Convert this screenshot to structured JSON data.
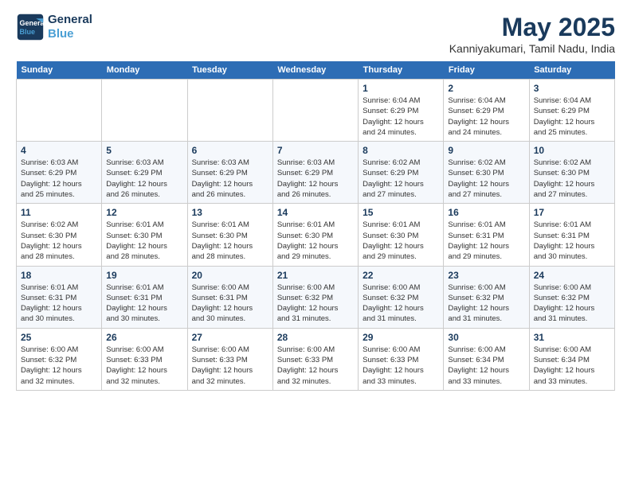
{
  "logo": {
    "line1": "General",
    "line2": "Blue"
  },
  "title": "May 2025",
  "location": "Kanniyakumari, Tamil Nadu, India",
  "days_of_week": [
    "Sunday",
    "Monday",
    "Tuesday",
    "Wednesday",
    "Thursday",
    "Friday",
    "Saturday"
  ],
  "weeks": [
    [
      {
        "day": "",
        "content": ""
      },
      {
        "day": "",
        "content": ""
      },
      {
        "day": "",
        "content": ""
      },
      {
        "day": "",
        "content": ""
      },
      {
        "day": "1",
        "content": "Sunrise: 6:04 AM\nSunset: 6:29 PM\nDaylight: 12 hours\nand 24 minutes."
      },
      {
        "day": "2",
        "content": "Sunrise: 6:04 AM\nSunset: 6:29 PM\nDaylight: 12 hours\nand 24 minutes."
      },
      {
        "day": "3",
        "content": "Sunrise: 6:04 AM\nSunset: 6:29 PM\nDaylight: 12 hours\nand 25 minutes."
      }
    ],
    [
      {
        "day": "4",
        "content": "Sunrise: 6:03 AM\nSunset: 6:29 PM\nDaylight: 12 hours\nand 25 minutes."
      },
      {
        "day": "5",
        "content": "Sunrise: 6:03 AM\nSunset: 6:29 PM\nDaylight: 12 hours\nand 26 minutes."
      },
      {
        "day": "6",
        "content": "Sunrise: 6:03 AM\nSunset: 6:29 PM\nDaylight: 12 hours\nand 26 minutes."
      },
      {
        "day": "7",
        "content": "Sunrise: 6:03 AM\nSunset: 6:29 PM\nDaylight: 12 hours\nand 26 minutes."
      },
      {
        "day": "8",
        "content": "Sunrise: 6:02 AM\nSunset: 6:29 PM\nDaylight: 12 hours\nand 27 minutes."
      },
      {
        "day": "9",
        "content": "Sunrise: 6:02 AM\nSunset: 6:30 PM\nDaylight: 12 hours\nand 27 minutes."
      },
      {
        "day": "10",
        "content": "Sunrise: 6:02 AM\nSunset: 6:30 PM\nDaylight: 12 hours\nand 27 minutes."
      }
    ],
    [
      {
        "day": "11",
        "content": "Sunrise: 6:02 AM\nSunset: 6:30 PM\nDaylight: 12 hours\nand 28 minutes."
      },
      {
        "day": "12",
        "content": "Sunrise: 6:01 AM\nSunset: 6:30 PM\nDaylight: 12 hours\nand 28 minutes."
      },
      {
        "day": "13",
        "content": "Sunrise: 6:01 AM\nSunset: 6:30 PM\nDaylight: 12 hours\nand 28 minutes."
      },
      {
        "day": "14",
        "content": "Sunrise: 6:01 AM\nSunset: 6:30 PM\nDaylight: 12 hours\nand 29 minutes."
      },
      {
        "day": "15",
        "content": "Sunrise: 6:01 AM\nSunset: 6:30 PM\nDaylight: 12 hours\nand 29 minutes."
      },
      {
        "day": "16",
        "content": "Sunrise: 6:01 AM\nSunset: 6:31 PM\nDaylight: 12 hours\nand 29 minutes."
      },
      {
        "day": "17",
        "content": "Sunrise: 6:01 AM\nSunset: 6:31 PM\nDaylight: 12 hours\nand 30 minutes."
      }
    ],
    [
      {
        "day": "18",
        "content": "Sunrise: 6:01 AM\nSunset: 6:31 PM\nDaylight: 12 hours\nand 30 minutes."
      },
      {
        "day": "19",
        "content": "Sunrise: 6:01 AM\nSunset: 6:31 PM\nDaylight: 12 hours\nand 30 minutes."
      },
      {
        "day": "20",
        "content": "Sunrise: 6:00 AM\nSunset: 6:31 PM\nDaylight: 12 hours\nand 30 minutes."
      },
      {
        "day": "21",
        "content": "Sunrise: 6:00 AM\nSunset: 6:32 PM\nDaylight: 12 hours\nand 31 minutes."
      },
      {
        "day": "22",
        "content": "Sunrise: 6:00 AM\nSunset: 6:32 PM\nDaylight: 12 hours\nand 31 minutes."
      },
      {
        "day": "23",
        "content": "Sunrise: 6:00 AM\nSunset: 6:32 PM\nDaylight: 12 hours\nand 31 minutes."
      },
      {
        "day": "24",
        "content": "Sunrise: 6:00 AM\nSunset: 6:32 PM\nDaylight: 12 hours\nand 31 minutes."
      }
    ],
    [
      {
        "day": "25",
        "content": "Sunrise: 6:00 AM\nSunset: 6:32 PM\nDaylight: 12 hours\nand 32 minutes."
      },
      {
        "day": "26",
        "content": "Sunrise: 6:00 AM\nSunset: 6:33 PM\nDaylight: 12 hours\nand 32 minutes."
      },
      {
        "day": "27",
        "content": "Sunrise: 6:00 AM\nSunset: 6:33 PM\nDaylight: 12 hours\nand 32 minutes."
      },
      {
        "day": "28",
        "content": "Sunrise: 6:00 AM\nSunset: 6:33 PM\nDaylight: 12 hours\nand 32 minutes."
      },
      {
        "day": "29",
        "content": "Sunrise: 6:00 AM\nSunset: 6:33 PM\nDaylight: 12 hours\nand 33 minutes."
      },
      {
        "day": "30",
        "content": "Sunrise: 6:00 AM\nSunset: 6:34 PM\nDaylight: 12 hours\nand 33 minutes."
      },
      {
        "day": "31",
        "content": "Sunrise: 6:00 AM\nSunset: 6:34 PM\nDaylight: 12 hours\nand 33 minutes."
      }
    ]
  ]
}
